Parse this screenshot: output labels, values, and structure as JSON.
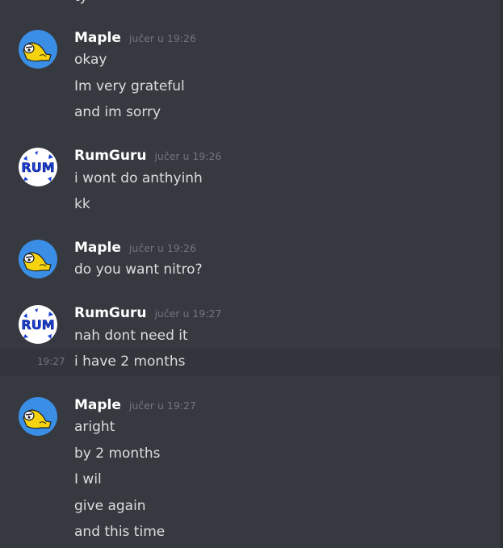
{
  "chat": {
    "cut_message": "ty",
    "groups": [
      {
        "author": "Maple",
        "timestamp": "jučer u 19:26",
        "avatar": "maple-avatar",
        "messages": [
          "okay",
          "Im very grateful",
          "and im sorry"
        ]
      },
      {
        "author": "RumGuru",
        "timestamp": "jučer u 19:26",
        "avatar": "rumguru-avatar",
        "messages": [
          "i wont do anthyinh",
          "kk"
        ]
      },
      {
        "author": "Maple",
        "timestamp": "jučer u 19:26",
        "avatar": "maple-avatar",
        "messages": [
          "do you want nitro?"
        ]
      },
      {
        "author": "RumGuru",
        "timestamp": "jučer u 19:27",
        "avatar": "rumguru-avatar",
        "messages": [
          "nah dont need it",
          "i have 2 months"
        ],
        "hover_time": "19:27"
      },
      {
        "author": "Maple",
        "timestamp": "jučer u 19:27",
        "avatar": "maple-avatar",
        "messages": [
          "aright",
          "by 2 months",
          "I wil",
          "give again",
          "and this time"
        ]
      }
    ]
  },
  "colors": {
    "background": "#36393f",
    "hover_row": "#32353b",
    "username": "#ffffff",
    "timestamp": "#72767d",
    "text": "#dcddde",
    "maple_avatar_bg": "#3a8ee6",
    "rumguru_avatar_text": "#1a3fd6"
  }
}
